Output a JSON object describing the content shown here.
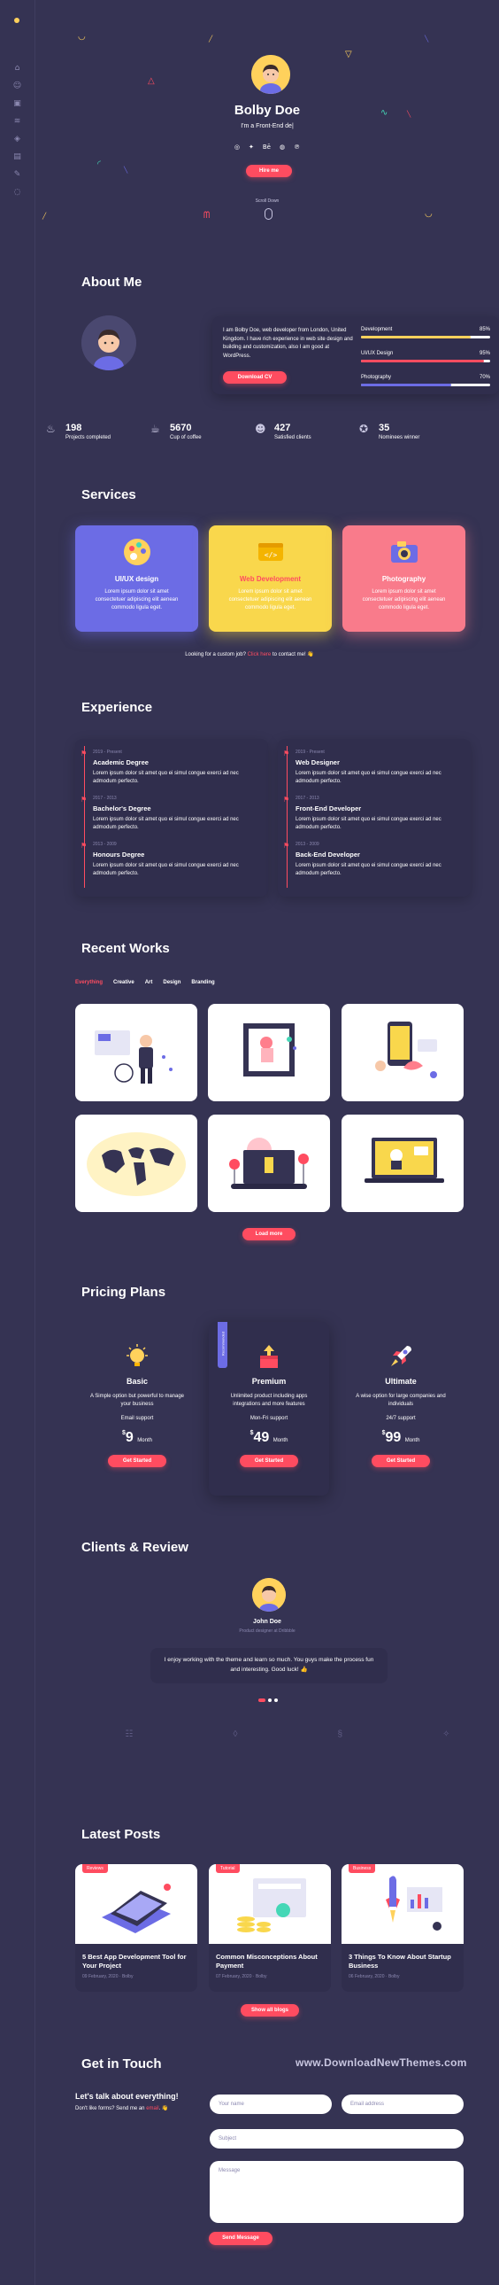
{
  "sidebar": {
    "icons": [
      "home-icon",
      "user-icon",
      "briefcase-icon",
      "layers-icon",
      "graduation-icon",
      "archive-icon",
      "edit-icon",
      "chat-icon"
    ]
  },
  "hero": {
    "name": "Bolby Doe",
    "role": "I'm a Front-End de|",
    "hire_label": "Hire me",
    "scroll_label": "Scroll Down",
    "socials": [
      "instagram-icon",
      "twitter-icon",
      "behance-icon",
      "dribbble-icon",
      "pinterest-icon"
    ]
  },
  "about": {
    "title": "About Me",
    "text": "I am Bolby Doe, web developer from London, United Kingdom. I have rich experience in web site design and building and customization, also I am good at WordPress.",
    "download_label": "Download CV",
    "skills": [
      {
        "name": "Development",
        "percent": "85%",
        "value": 85,
        "color": "#FFD15C"
      },
      {
        "name": "UI/UX Design",
        "percent": "95%",
        "value": 95,
        "color": "#FF4C60"
      },
      {
        "name": "Photography",
        "percent": "70%",
        "value": 70,
        "color": "#6C6CE5"
      }
    ],
    "stats": [
      {
        "icon": "fire-icon",
        "number": "198",
        "label": "Projects completed"
      },
      {
        "icon": "cup-icon",
        "number": "5670",
        "label": "Cup of coffee"
      },
      {
        "icon": "people-icon",
        "number": "427",
        "label": "Satisfied clients"
      },
      {
        "icon": "badge-icon",
        "number": "35",
        "label": "Nominees winner"
      }
    ]
  },
  "services": {
    "title": "Services",
    "items": [
      {
        "title": "UI/UX design",
        "text": "Lorem ipsum dolor sit amet consectetuer adipiscing elit aenean commodo ligula eget.",
        "color": "#6C6CE5"
      },
      {
        "title": "Web Development",
        "text": "Lorem ipsum dolor sit amet consectetuer adipiscing elit aenean commodo ligula eget.",
        "color": "#F9D74C"
      },
      {
        "title": "Photography",
        "text": "Lorem ipsum dolor sit amet consectetuer adipiscing elit aenean commodo ligula eget.",
        "color": "#F97B8B"
      }
    ],
    "custom_job_prefix": "Looking for a custom job?",
    "custom_job_link": "Click here",
    "custom_job_suffix": "to contact me! 👋"
  },
  "experience": {
    "title": "Experience",
    "education": [
      {
        "date": "2019 - Present",
        "title": "Academic Degree",
        "desc": "Lorem ipsum dolor sit amet quo ei simul congue exerci ad nec admodum perfecto."
      },
      {
        "date": "2017 - 2013",
        "title": "Bachelor's Degree",
        "desc": "Lorem ipsum dolor sit amet quo ei simul congue exerci ad nec admodum perfecto."
      },
      {
        "date": "2013 - 2009",
        "title": "Honours Degree",
        "desc": "Lorem ipsum dolor sit amet quo ei simul congue exerci ad nec admodum perfecto."
      }
    ],
    "work": [
      {
        "date": "2019 - Present",
        "title": "Web Designer",
        "desc": "Lorem ipsum dolor sit amet quo ei simul congue exerci ad nec admodum perfecto."
      },
      {
        "date": "2017 - 2013",
        "title": "Front-End Developer",
        "desc": "Lorem ipsum dolor sit amet quo ei simul congue exerci ad nec admodum perfecto."
      },
      {
        "date": "2013 - 2009",
        "title": "Back-End Developer",
        "desc": "Lorem ipsum dolor sit amet quo ei simul congue exerci ad nec admodum perfecto."
      }
    ]
  },
  "works": {
    "title": "Recent Works",
    "filters": [
      "Everything",
      "Creative",
      "Art",
      "Design",
      "Branding"
    ],
    "load_more": "Load more"
  },
  "pricing": {
    "title": "Pricing Plans",
    "recommended": "Recommended",
    "plans": [
      {
        "name": "Basic",
        "desc": "A Simple option but powerful to manage your business",
        "support": "Email support",
        "currency": "$",
        "price": "9",
        "period": "Month",
        "cta": "Get Started",
        "icon": "bulb-icon"
      },
      {
        "name": "Premium",
        "desc": "Unlimited product including apps integrations and more features",
        "support": "Mon-Fri support",
        "currency": "$",
        "price": "49",
        "period": "Month",
        "cta": "Get Started",
        "icon": "box-icon"
      },
      {
        "name": "Ultimate",
        "desc": "A wise option for large companies and individuals",
        "support": "24/7 support",
        "currency": "$",
        "price": "99",
        "period": "Month",
        "cta": "Get Started",
        "icon": "rocket-icon"
      }
    ]
  },
  "clients": {
    "title": "Clients & Review",
    "name": "John Doe",
    "role": "Product designer at Dribbble",
    "quote": "I enjoy working with the theme and learn so much. You guys make the process fun and interesting. Good luck! 👍"
  },
  "posts": {
    "title": "Latest Posts",
    "items": [
      {
        "tag": "Reviews",
        "title": "5 Best App Development Tool for Your Project",
        "date": "09 February, 2020",
        "author": "Bolby"
      },
      {
        "tag": "Tutorial",
        "title": "Common Misconceptions About Payment",
        "date": "07 February, 2020",
        "author": "Bolby"
      },
      {
        "tag": "Business",
        "title": "3 Things To Know About Startup Business",
        "date": "06 February, 2020",
        "author": "Bolby"
      }
    ],
    "show_all": "Show all blogs"
  },
  "contact": {
    "title": "Get in Touch",
    "watermark": "www.DownloadNewThemes.com",
    "heading": "Let's talk about everything!",
    "sub_prefix": "Don't like forms? Send me an",
    "sub_link": "email",
    "sub_suffix": ". 👋",
    "name_placeholder": "Your name",
    "email_placeholder": "Email address",
    "subject_placeholder": "Subject",
    "message_placeholder": "Message",
    "send_label": "Send Message"
  }
}
